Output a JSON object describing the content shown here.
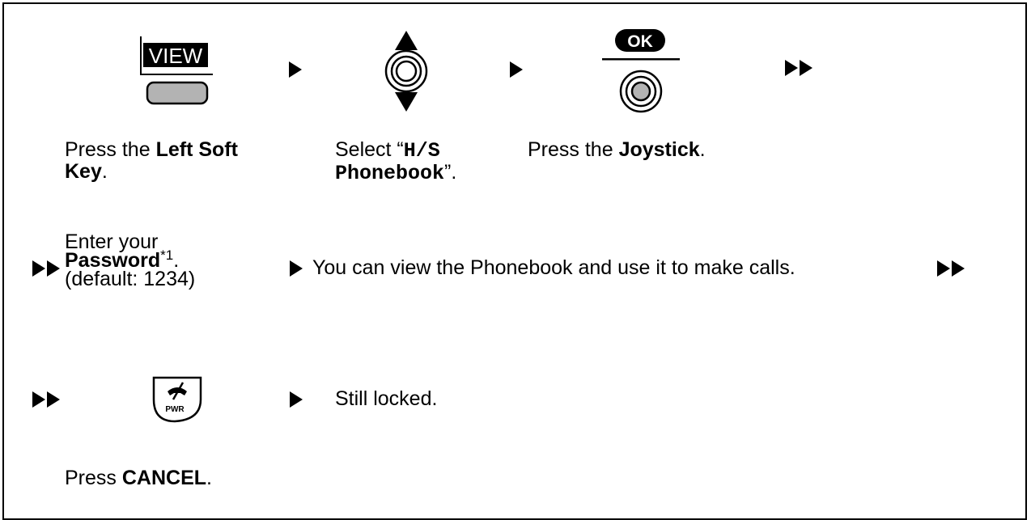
{
  "colors": {
    "line": "#000000",
    "key_fill": "#b3b3b3",
    "background": "#ffffff"
  },
  "view_key": {
    "label": "VIEW"
  },
  "ok_key": {
    "label": "OK"
  },
  "cancel_key": {
    "label": "PWR"
  },
  "step1": {
    "pre": "Press the ",
    "bold_a": "Left Soft",
    "bold_b": "Key",
    "post": "."
  },
  "step2": {
    "pre": "Select “",
    "code_a": "H/S",
    "code_b": "Phonebook",
    "post": "”."
  },
  "step3": {
    "pre": "Press the ",
    "bold": "Joystick",
    "post": "."
  },
  "step4": {
    "line1": "Enter your",
    "bold": "Password",
    "sup": "*1",
    "post": ".",
    "line3": "(default: 1234)"
  },
  "step5": {
    "text": "You can view the Phonebook and use it to make calls."
  },
  "step6": {
    "text": "Still locked."
  },
  "step7": {
    "pre": "Press ",
    "bold": "CANCEL",
    "post": "."
  },
  "icons": [
    "play-arrow-icon",
    "double-play-arrow-icon",
    "joystick-updown-icon",
    "joystick-press-icon",
    "cancel-pwr-key-icon",
    "left-soft-key-icon"
  ]
}
